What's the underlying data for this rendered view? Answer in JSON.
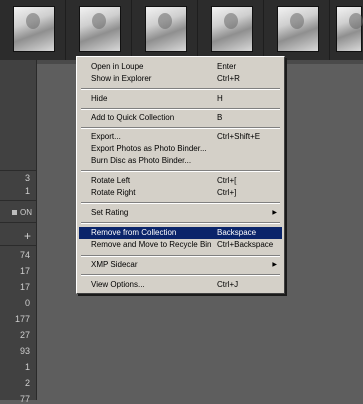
{
  "left_panel": {
    "counts_top": [
      "3",
      "1"
    ],
    "on_label": "ON",
    "plus_label": "+",
    "counts_bottom": [
      "74",
      "17",
      "17",
      "0",
      "177",
      "27",
      "93",
      "1",
      "2",
      "77"
    ]
  },
  "menu": {
    "open_loupe": {
      "label": "Open in Loupe",
      "shortcut": "Enter"
    },
    "show_explorer": {
      "label": "Show in Explorer",
      "shortcut": "Ctrl+R"
    },
    "hide": {
      "label": "Hide",
      "shortcut": "H"
    },
    "add_quick": {
      "label": "Add to Quick Collection",
      "shortcut": "B"
    },
    "export": {
      "label": "Export...",
      "shortcut": "Ctrl+Shift+E"
    },
    "export_binder": {
      "label": "Export Photos as Photo Binder..."
    },
    "burn_disc": {
      "label": "Burn Disc as Photo Binder..."
    },
    "rotate_left": {
      "label": "Rotate Left",
      "shortcut": "Ctrl+["
    },
    "rotate_right": {
      "label": "Rotate Right",
      "shortcut": "Ctrl+]"
    },
    "set_rating": {
      "label": "Set Rating",
      "arrow": "▶"
    },
    "remove_collection": {
      "label": "Remove from Collection",
      "shortcut": "Backspace"
    },
    "remove_recycle": {
      "label": "Remove and Move to Recycle Bin",
      "shortcut": "Ctrl+Backspace"
    },
    "xmp_sidecar": {
      "label": "XMP Sidecar",
      "arrow": "▶"
    },
    "view_options": {
      "label": "View Options...",
      "shortcut": "Ctrl+J"
    }
  },
  "colors": {
    "menu_bg": "#d4d0c8",
    "selection": "#0a246a",
    "background": "#5e5e5e"
  }
}
